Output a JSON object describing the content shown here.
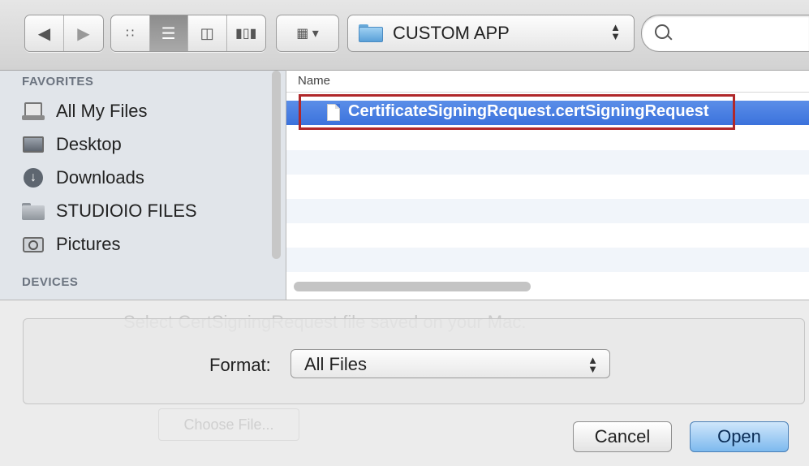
{
  "toolbar": {
    "back_icon": "back-arrow-icon",
    "forward_icon": "forward-arrow-icon",
    "view_modes": [
      "icon-view-icon",
      "list-view-icon",
      "column-view-icon",
      "coverflow-view-icon"
    ],
    "active_view": "list-view-icon",
    "arrange_icon": "arrange-icon",
    "location": "CUSTOM APP",
    "search_placeholder": ""
  },
  "sidebar": {
    "favorites_header": "FAVORITES",
    "items": [
      {
        "label": "All My Files",
        "icon": "all-files-icon"
      },
      {
        "label": "Desktop",
        "icon": "desktop-icon"
      },
      {
        "label": "Downloads",
        "icon": "downloads-icon"
      },
      {
        "label": "STUDIOIO FILES",
        "icon": "folder-icon"
      },
      {
        "label": "Pictures",
        "icon": "camera-icon"
      }
    ],
    "devices_header": "DEVICES"
  },
  "file_list": {
    "column_name": "Name",
    "selected_file": "CertificateSigningRequest.certSigningRequest"
  },
  "bottom": {
    "background_text": "Select CertSigningRequest file saved on your Mac.",
    "background_button": "Choose File...",
    "format_label": "Format:",
    "format_value": "All Files",
    "cancel_label": "Cancel",
    "open_label": "Open"
  },
  "colors": {
    "selection": "#3b72dc",
    "highlight_box": "#b0282a",
    "sidebar_bg": "#e1e5ea"
  }
}
